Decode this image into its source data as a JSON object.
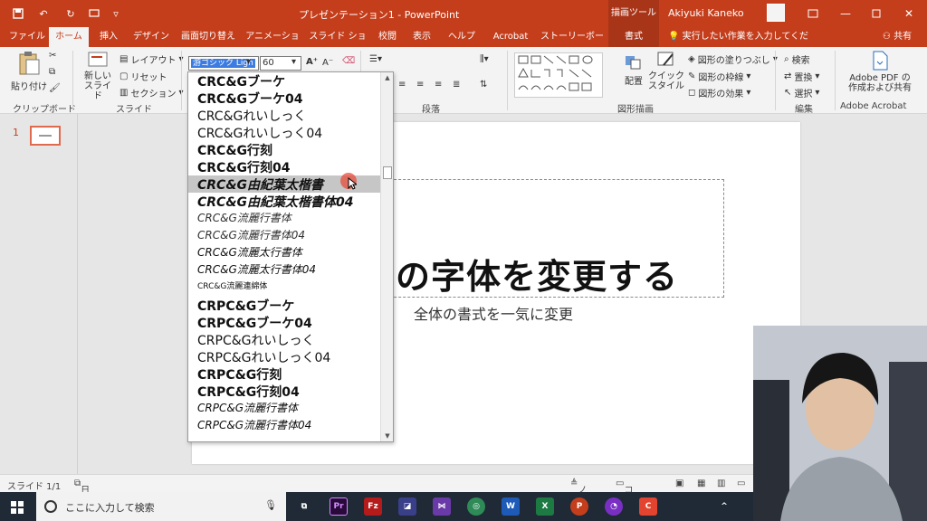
{
  "titlebar": {
    "title": "プレゼンテーション1 - PowerPoint",
    "context_tab": "描画ツール",
    "user": "Akiyuki Kaneko"
  },
  "tabs": [
    "ファイル",
    "ホーム",
    "挿入",
    "デザイン",
    "画面切り替え",
    "アニメーション",
    "スライド ショー",
    "校閲",
    "表示",
    "ヘルプ",
    "Acrobat",
    "ストーリーボード",
    "書式"
  ],
  "tell_me": "実行したい作業を入力してください",
  "share": "共有",
  "ribbon": {
    "clipboard": {
      "paste": "貼り付け",
      "label": "クリップボード"
    },
    "slides": {
      "new_slide": "新しい\nスライド",
      "layout": "レイアウト",
      "reset": "リセット",
      "section": "セクション",
      "label": "スライド"
    },
    "font": {
      "name": "游ゴシック Ligh",
      "size": "60"
    },
    "paragraph": {
      "label": "段落"
    },
    "drawing": {
      "arrange": "配置",
      "quick_style": "クイック\nスタイル",
      "fill": "図形の塗りつぶし",
      "outline": "図形の枠線",
      "effects": "図形の効果",
      "label": "図形描画"
    },
    "editing": {
      "find": "検索",
      "replace": "置換",
      "select": "選択",
      "label": "編集"
    },
    "acrobat": {
      "create": "Adobe PDF の\n作成および共有",
      "label": "Adobe Acrobat"
    }
  },
  "font_list": [
    "CRC&Gブーケ",
    "CRC&Gブーケ04",
    "CRC&Gれいしっく",
    "CRC&Gれいしっく04",
    "CRC&G行刻",
    "CRC&G行刻04",
    "CRC&G由紀葉太楷書",
    "CRC&G由紀葉太楷書体04",
    "CRC&G流麗行書体",
    "CRC&G流麗行書体04",
    "CRC&G流麗太行書体",
    "CRC&G流麗太行書体04",
    "CRC&G流麗連綿体",
    "CRPC&Gブーケ",
    "CRPC&Gブーケ04",
    "CRPC&Gれいしっく",
    "CRPC&Gれいしっく04",
    "CRPC&G行刻",
    "CRPC&G行刻04",
    "CRPC&G流麗行書体",
    "CRPC&G流麗行書体04"
  ],
  "slide": {
    "number": "1",
    "title": "の字体を変更する",
    "subtitle": "全体の書式を一気に変更"
  },
  "statusbar": {
    "slide": "スライド 1/1",
    "language": "日本語",
    "notes": "ノート",
    "comments": "コメント"
  },
  "taskbar": {
    "search_placeholder": "ここに入力して検索"
  },
  "colors": {
    "accent": "#c43e1c",
    "taskbar": "#1f2a36"
  }
}
